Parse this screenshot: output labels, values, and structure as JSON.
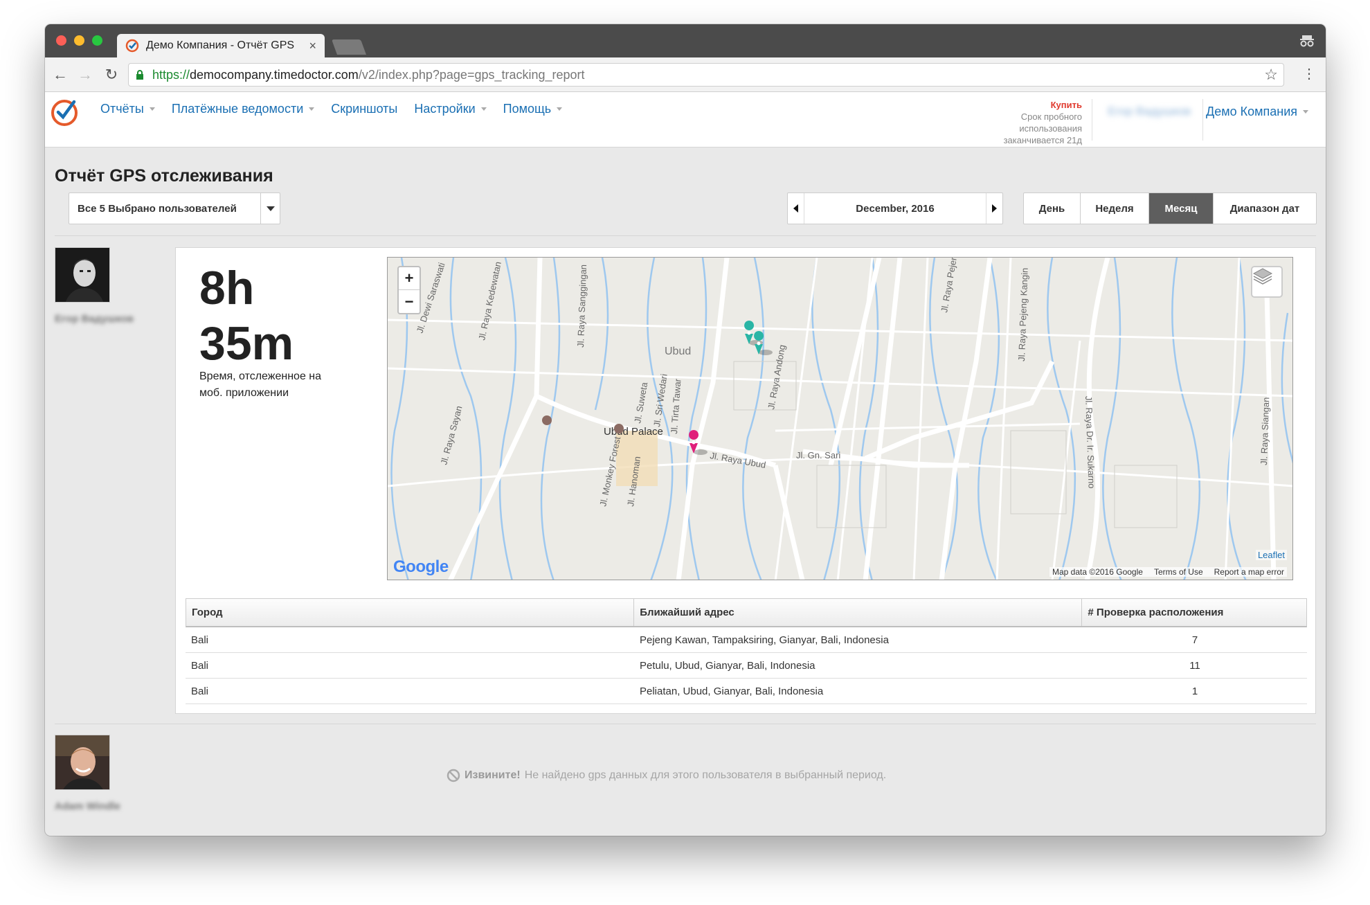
{
  "browser": {
    "tab_title": "Демо Компания - Отчёт GPS",
    "tab_close": "×",
    "url_scheme": "https://",
    "url_host": "democompany.timedoctor.com",
    "url_path": "/v2/index.php?page=gps_tracking_report"
  },
  "nav": {
    "items": [
      {
        "label": "Отчёты",
        "has_caret": true
      },
      {
        "label": "Платёжные ведомости",
        "has_caret": true
      },
      {
        "label": "Скриншоты",
        "has_caret": false
      },
      {
        "label": "Настройки",
        "has_caret": true
      },
      {
        "label": "Помощь",
        "has_caret": true
      }
    ],
    "trial_buy": "Купить",
    "trial_line1": "Срок пробного",
    "trial_line2": "использования",
    "trial_line3": "заканчивается 21д",
    "user_name": "Егор Вадушков",
    "company": "Демо Компания"
  },
  "report": {
    "title": "Отчёт GPS отслеживания",
    "user_filter": "Все 5 Выбрано пользователей",
    "period": "December, 2016",
    "ranges": [
      {
        "label": "День",
        "active": false
      },
      {
        "label": "Неделя",
        "active": false
      },
      {
        "label": "Месяц",
        "active": true
      },
      {
        "label": "Диапазон дат",
        "active": false
      }
    ]
  },
  "users": [
    {
      "name": "Егор Вадушков",
      "hours": "8h",
      "minutes": "35m",
      "tracked_label": "Время, отслеженное на моб. приложении",
      "map": {
        "zoom_in": "+",
        "zoom_out": "−",
        "labels": {
          "ubud": "Ubud",
          "palace": "Ubud Palace",
          "raya_ubud": "Jl. Raya Ubud",
          "gn_sari": "Jl. Gn. Sari",
          "kedewatan": "Jl. Raya Kedewatan",
          "sanggingan": "Jl. Raya Sanggingan",
          "andong": "Jl. Raya Andong",
          "pejeng": "Jl. Raya Pejeng",
          "pejeng_kangin": "Jl. Raya Pejeng Kangin",
          "sukarno": "Jl. Raya Dr. Ir. Sukarno",
          "siangan": "Jl. Raya Siangan",
          "sayan": "Jl. Raya Sayan",
          "monkey": "Jl. Monkey Forest",
          "hanoman": "Jl. Hanoman",
          "suweta": "Jl. Suweta",
          "sri_wedari": "Jl. Sri Wedari",
          "tirta_tawar": "Jl. Tirta Tawar",
          "dewi_saraswati": "Jl. Dewi Saraswati"
        },
        "leaflet": "Leaflet",
        "attrib_data": "Map data ©2016 Google",
        "attrib_terms": "Terms of Use",
        "attrib_report": "Report a map error",
        "google": "Google",
        "pin_colors": {
          "checkin": "#2ab5a5",
          "current": "#e0207a"
        }
      },
      "table": {
        "headers": [
          "Город",
          "Ближайший адрес",
          "# Проверка расположения"
        ],
        "rows": [
          [
            "Bali",
            "Pejeng Kawan, Tampaksiring, Gianyar, Bali, Indonesia",
            "7"
          ],
          [
            "Bali",
            "Petulu, Ubud, Gianyar, Bali, Indonesia",
            "11"
          ],
          [
            "Bali",
            "Peliatan, Ubud, Gianyar, Bali, Indonesia",
            "1"
          ]
        ]
      }
    },
    {
      "name": "Adam Windle",
      "no_data_bold": "Извините!",
      "no_data_text": "Не найдено gps данных для этого пользователя в выбранный период."
    }
  ]
}
